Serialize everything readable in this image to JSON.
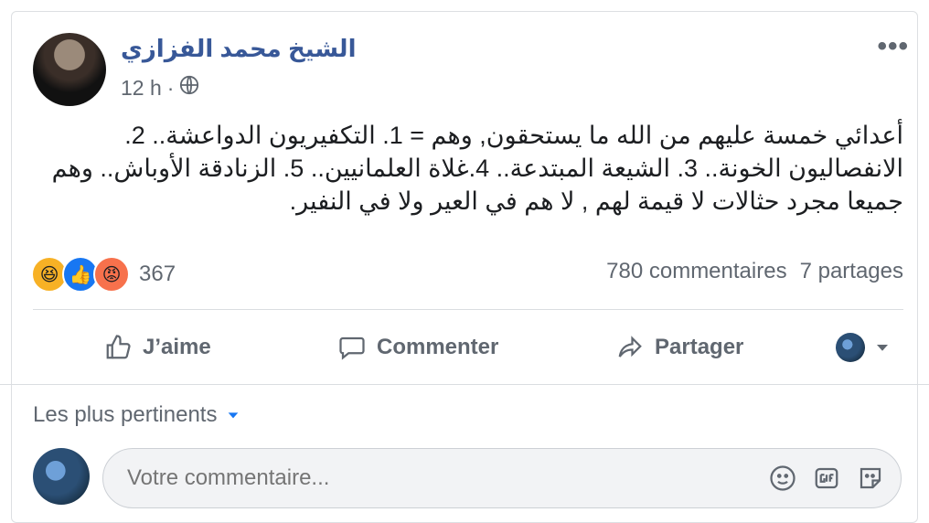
{
  "post": {
    "author": "الشيخ محمد الفزازي",
    "time": "12 h",
    "privacy_icon": "globe-icon",
    "text": "أعدائي خمسة عليهم من الله ما يستحقون, وهم = 1. التكفيريون الدواعشة.. 2. الانفصاليون الخونة.. 3. الشيعة المبتدعة.. 4.غلاة العلمانيين.. 5. الزنادقة الأوباش.. وهم جميعا مجرد حثالات لا قيمة لهم , لا هم في العير ولا في النفير."
  },
  "reactions": {
    "count": "367",
    "types": [
      "haha-icon",
      "like-icon",
      "angry-icon"
    ]
  },
  "stats": {
    "comments": "780 commentaires",
    "shares": "7 partages"
  },
  "actions": {
    "like": "J’aime",
    "comment": "Commenter",
    "share": "Partager"
  },
  "comments": {
    "sort_label": "Les plus pertinents",
    "placeholder": "Votre commentaire..."
  },
  "colors": {
    "name": "#385898",
    "muted": "#606770",
    "like": "#1877f2",
    "angry": "#f7714c",
    "haha": "#f7b125"
  }
}
